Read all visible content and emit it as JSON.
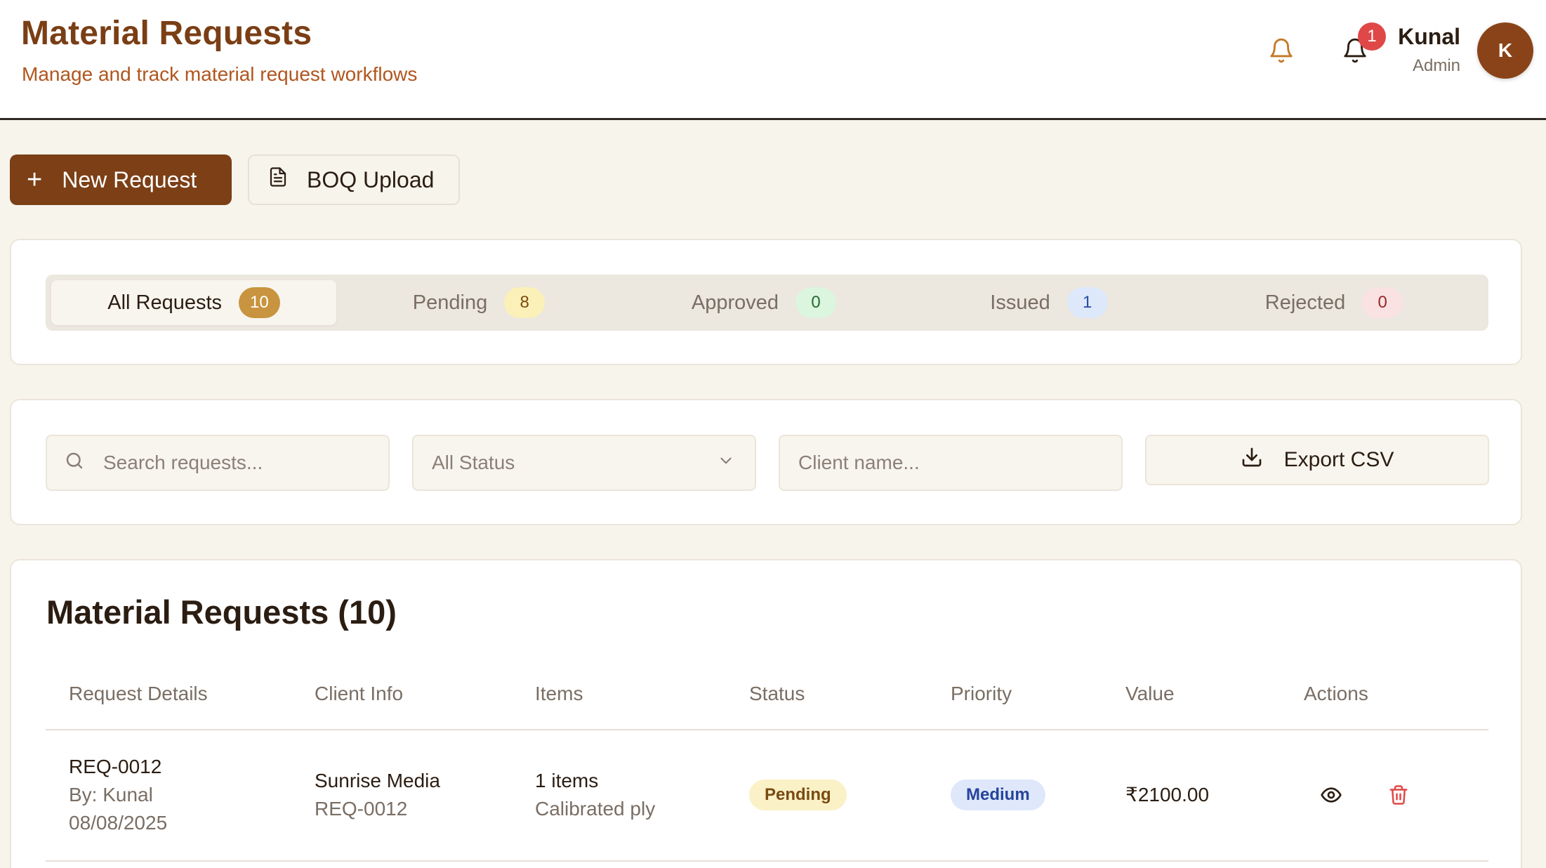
{
  "header": {
    "title": "Material Requests",
    "subtitle": "Manage and track material request workflows",
    "notification_count": "1",
    "user": {
      "name": "Kunal",
      "role": "Admin",
      "initial": "K"
    }
  },
  "actions": {
    "new_request_label": "New Request",
    "boq_upload_label": "BOQ Upload"
  },
  "tabs": [
    {
      "label": "All Requests",
      "count": "10",
      "active": true,
      "badge_bg": "#c9943f",
      "badge_fg": "#ffffff"
    },
    {
      "label": "Pending",
      "count": "8",
      "active": false,
      "badge_bg": "#fbf1b8",
      "badge_fg": "#7a4a12"
    },
    {
      "label": "Approved",
      "count": "0",
      "active": false,
      "badge_bg": "#dcf5df",
      "badge_fg": "#256b33"
    },
    {
      "label": "Issued",
      "count": "1",
      "active": false,
      "badge_bg": "#dde8fb",
      "badge_fg": "#2a4da3"
    },
    {
      "label": "Rejected",
      "count": "0",
      "active": false,
      "badge_bg": "#fbe2e2",
      "badge_fg": "#9b2626"
    }
  ],
  "filters": {
    "search_placeholder": "Search requests...",
    "status_value": "All Status",
    "client_placeholder": "Client name...",
    "export_label": "Export CSV"
  },
  "table": {
    "title": "Material Requests (10)",
    "columns": [
      "Request Details",
      "Client Info",
      "Items",
      "Status",
      "Priority",
      "Value",
      "Actions"
    ],
    "rows": [
      {
        "id": "REQ-0012",
        "by": "By: Kunal",
        "date": "08/08/2025",
        "client_name": "Sunrise Media",
        "client_ref": "REQ-0012",
        "items_count": "1 items",
        "items_desc": "Calibrated ply",
        "status": "Pending",
        "priority": "Medium",
        "value": "₹2100.00"
      }
    ]
  },
  "colors": {
    "brand": "#7c3f16",
    "accent_text": "#b0561e",
    "background": "#f7f4ec",
    "danger": "#e04848"
  },
  "icons": {
    "bell": "bell-icon",
    "plus": "plus-icon",
    "document": "document-icon",
    "search": "search-icon",
    "chevron": "chevron-down-icon",
    "download": "download-icon",
    "view": "eye-icon",
    "delete": "trash-icon"
  }
}
